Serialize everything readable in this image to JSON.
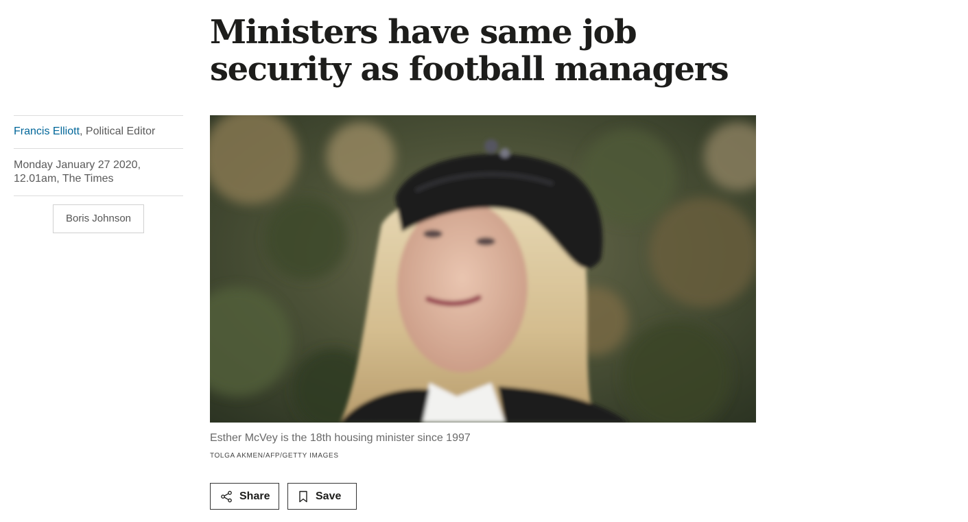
{
  "article": {
    "headline": "Ministers have same job security as football managers",
    "author": "Francis Elliott",
    "author_role": ", Political Editor",
    "date": "Monday January 27 2020, 12.01am, The Times",
    "tags": [
      "Boris Johnson"
    ],
    "image": {
      "caption": "Esther McVey is the 18th housing minister since 1997",
      "credit": "TOLGA AKMEN/AFP/GETTY IMAGES"
    }
  },
  "actions": {
    "share_label": "Share",
    "save_label": "Save",
    "share_icon": "share-icon",
    "save_icon": "bookmark-icon"
  },
  "colors": {
    "author_link": "#006699",
    "headline": "#1d1d1b",
    "meta_text": "#5a5a5a",
    "divider": "#dcdcdc"
  }
}
